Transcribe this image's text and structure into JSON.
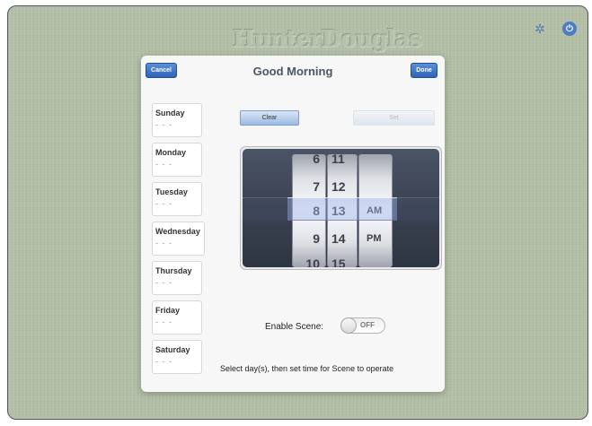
{
  "brand": {
    "name": "HunterDouglas"
  },
  "top_icons": [
    {
      "icon": "gear-icon",
      "glyph": "✲"
    },
    {
      "icon": "power-icon",
      "glyph": "⏻"
    }
  ],
  "dialog": {
    "title": "Good Morning",
    "cancel_label": "Cancel",
    "done_label": "Done"
  },
  "days": [
    {
      "name": "Sunday",
      "time": "- - -"
    },
    {
      "name": "Monday",
      "time": "- - -"
    },
    {
      "name": "Tuesday",
      "time": "- - -"
    },
    {
      "name": "Wednesday",
      "time": "- - -"
    },
    {
      "name": "Thursday",
      "time": "- - -"
    },
    {
      "name": "Friday",
      "time": "- - -"
    },
    {
      "name": "Saturday",
      "time": "- - -"
    }
  ],
  "actions": {
    "clear_label": "Clear",
    "set_label": "Set"
  },
  "time_picker": {
    "hours": [
      "6",
      "7",
      "8",
      "9",
      "10"
    ],
    "minutes": [
      "11",
      "12",
      "13",
      "14",
      "15"
    ],
    "periods": [
      "AM",
      "PM"
    ],
    "selected": {
      "hour": "8",
      "minute": "13",
      "period": "AM"
    }
  },
  "scene_toggle": {
    "label": "Enable Scene:",
    "state": "OFF"
  },
  "instruction": "Select day(s), then set time for Scene to operate",
  "colors": {
    "background": "#b3bfa7",
    "button_blue": "#2f63b6",
    "dialog": "#f7f7f7"
  }
}
